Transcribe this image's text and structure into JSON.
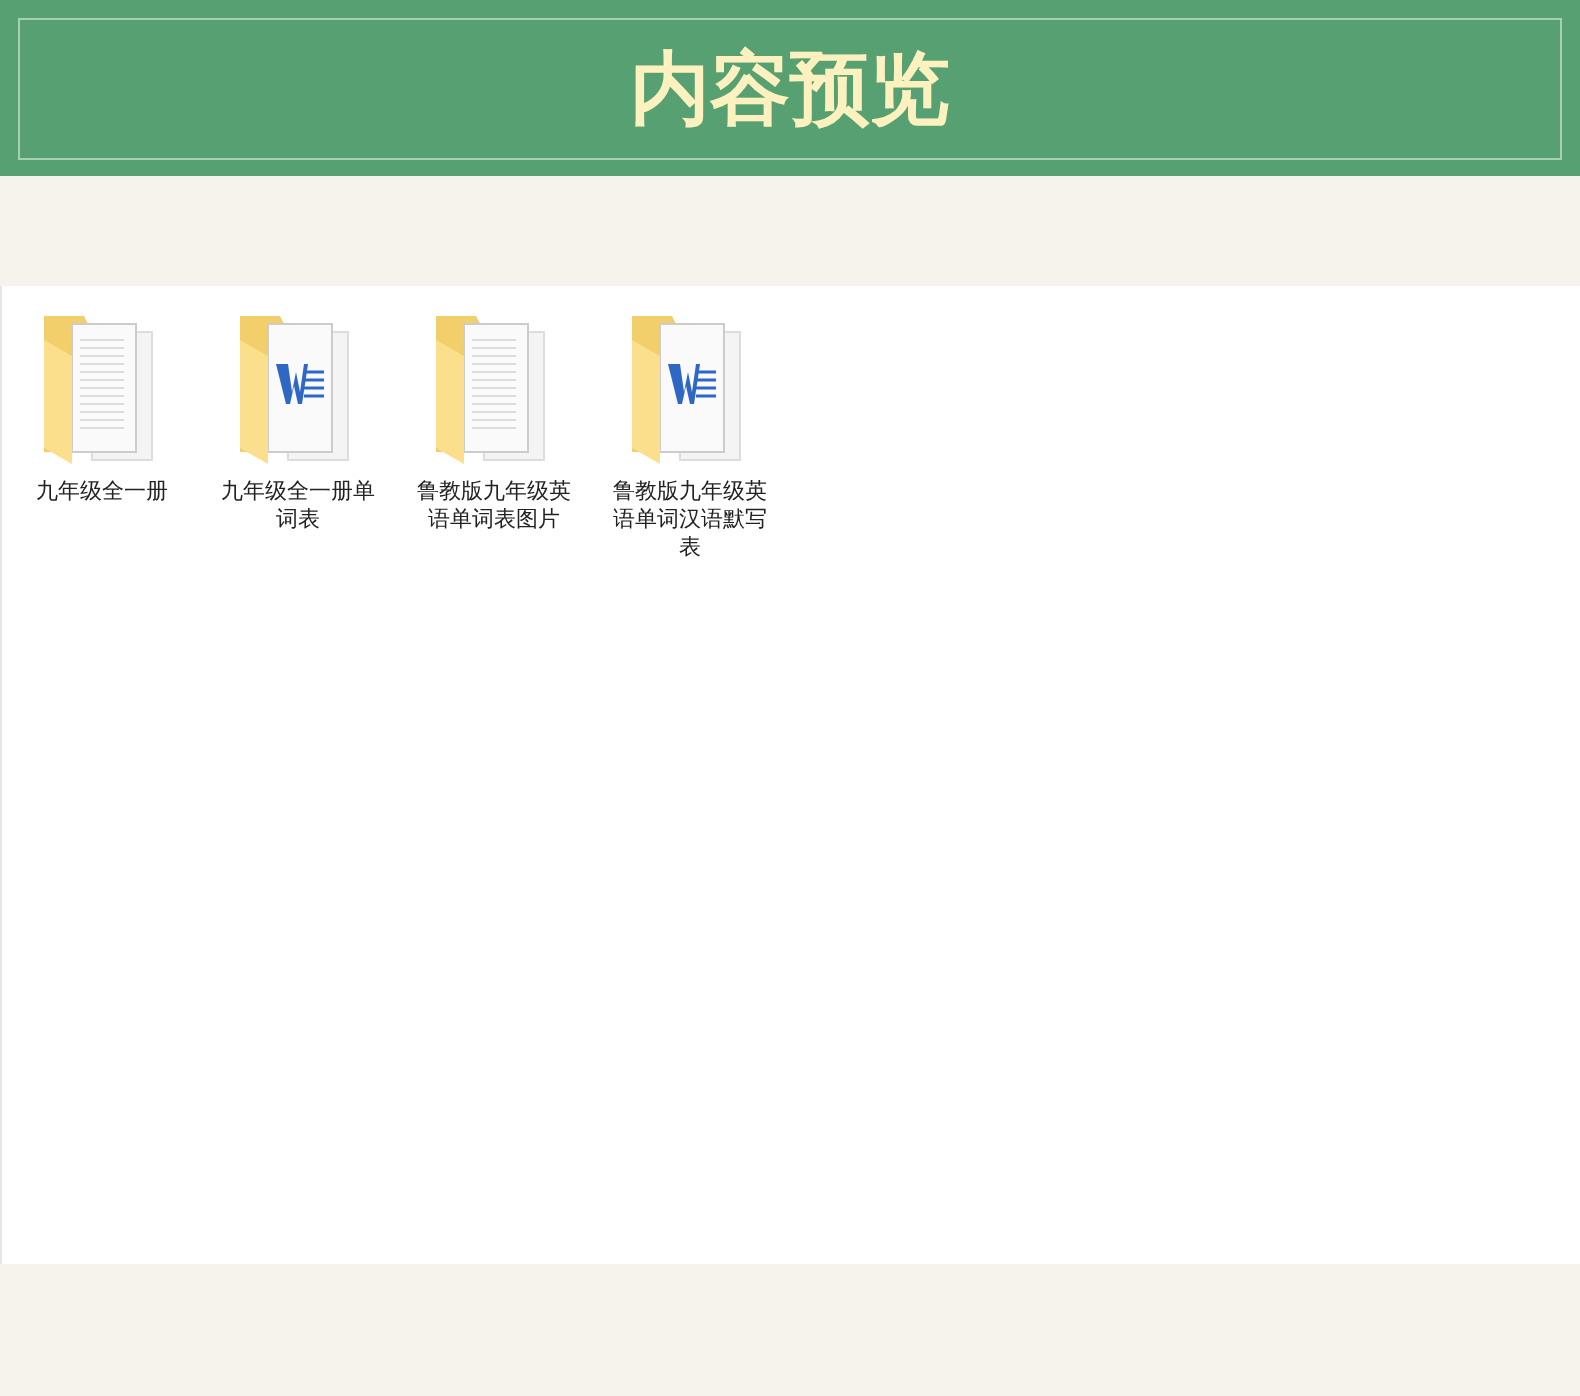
{
  "header": {
    "title": "内容预览"
  },
  "files": [
    {
      "name": "九年级全一册",
      "kind": "plain"
    },
    {
      "name": "九年级全一册单词表",
      "kind": "word"
    },
    {
      "name": "鲁教版九年级英语单词表图片",
      "kind": "plain"
    },
    {
      "name": "鲁教版九年级英语单词汉语默写表",
      "kind": "word"
    }
  ]
}
